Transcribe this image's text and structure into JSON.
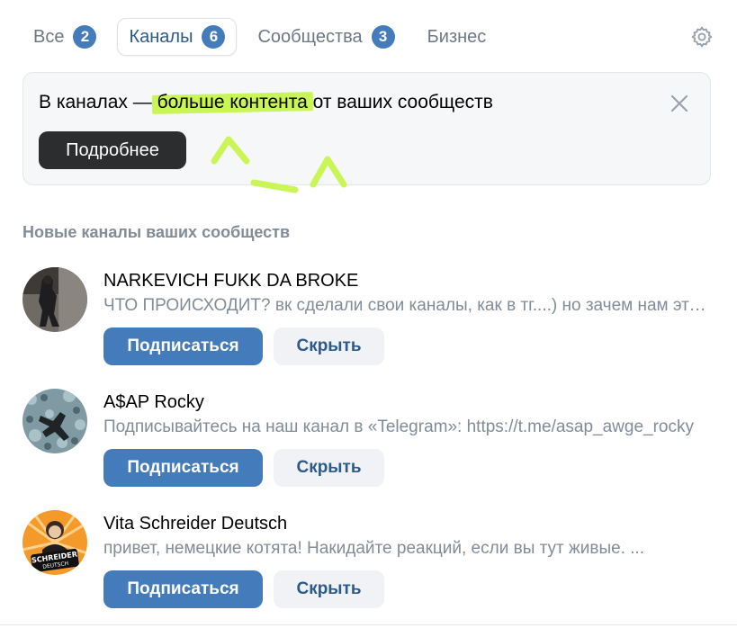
{
  "tabs": [
    {
      "label": "Все",
      "count": "2",
      "active": false
    },
    {
      "label": "Каналы",
      "count": "6",
      "active": true
    },
    {
      "label": "Сообщества",
      "count": "3",
      "active": false
    },
    {
      "label": "Бизнес",
      "count": null,
      "active": false
    }
  ],
  "banner": {
    "text_before": "В каналах — ",
    "text_highlight": "больше контента",
    "text_after": " от ваших сообществ",
    "button_label": "Подробнее"
  },
  "section_title": "Новые каналы ваших сообществ",
  "channels": [
    {
      "name": "NARKEVICH FUKK DA BROKE",
      "description": "ЧТО ПРОИСХОДИТ? вк сделали свои каналы, как в тг....) но зачем нам это..."
    },
    {
      "name": "A$AP Rocky",
      "description": "Подписывайтесь на наш канал в «Telegram»: https://t.me/asap_awge_rocky"
    },
    {
      "name": "Vita Schreider Deutsch",
      "description": "привет, немецкие котята! Накидайте реакций, если вы тут живые. ..."
    }
  ],
  "buttons": {
    "subscribe_label": "Подписаться",
    "hide_label": "Скрыть"
  },
  "avatar3_text": {
    "line1": "SCHREIDER",
    "line2": "DEUTSCH"
  },
  "colors": {
    "accent": "#447bba",
    "accent_text": "#2c5a8c",
    "highlight": "#c9f556",
    "muted": "#818c99",
    "dark_button": "#2c2d2e"
  },
  "icons": {
    "settings": "gear-icon",
    "close": "close-icon"
  }
}
